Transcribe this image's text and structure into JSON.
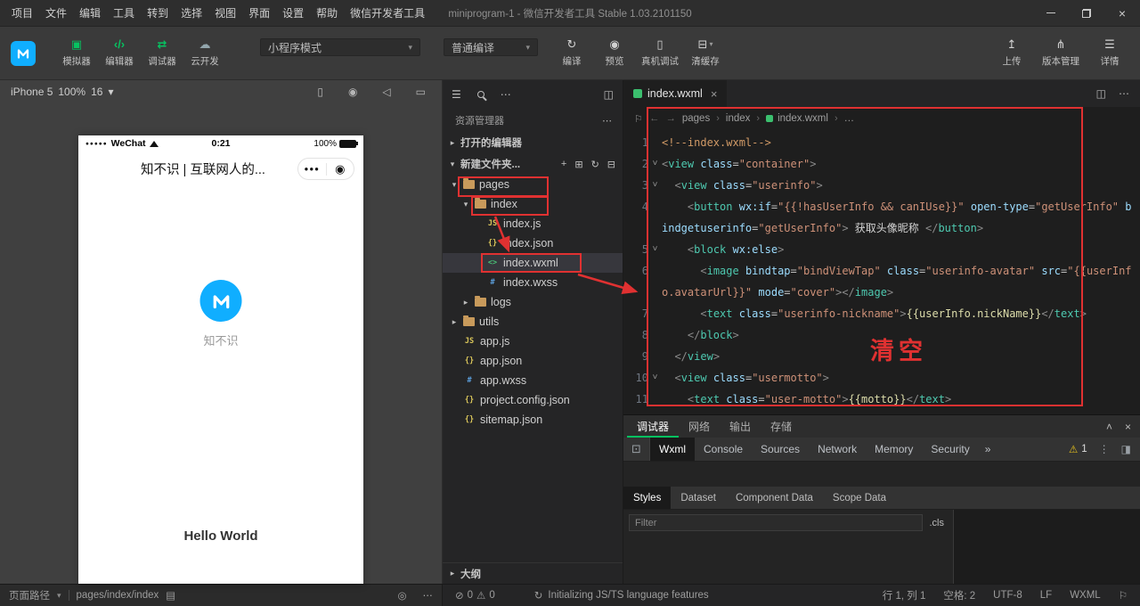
{
  "colors": {
    "accent_green": "#07c160",
    "annotation_red": "#e03131",
    "brand_blue": "#10aeff"
  },
  "title_bar": {
    "menus": [
      "项目",
      "文件",
      "编辑",
      "工具",
      "转到",
      "选择",
      "视图",
      "界面",
      "设置",
      "帮助",
      "微信开发者工具"
    ],
    "title": "miniprogram-1 - 微信开发者工具 Stable 1.03.2101150"
  },
  "toolbar": {
    "mode_buttons": [
      {
        "name": "simulator",
        "label": "模拟器",
        "icon": "▣",
        "style": "ic-green"
      },
      {
        "name": "editor",
        "label": "编辑器",
        "icon": "‹/›",
        "style": "ic-green"
      },
      {
        "name": "debugger",
        "label": "调试器",
        "icon": "⇄",
        "style": "ic-green"
      },
      {
        "name": "cloud-dev",
        "label": "云开发",
        "icon": "☁",
        "style": "ic-gray"
      }
    ],
    "mode_select": "小程序模式",
    "compile_select": "普通编译",
    "actions": [
      {
        "name": "compile",
        "label": "编译",
        "icon": "↻"
      },
      {
        "name": "preview",
        "label": "预览",
        "icon": "◉"
      },
      {
        "name": "device-debug",
        "label": "真机调试",
        "icon": "▯"
      },
      {
        "name": "clear-cache",
        "label": "清缓存",
        "icon": "⊟",
        "caret": true
      }
    ],
    "right_actions": [
      {
        "name": "upload",
        "label": "上传",
        "icon": "↥"
      },
      {
        "name": "version-manage",
        "label": "版本管理",
        "icon": "⋔"
      },
      {
        "name": "details",
        "label": "详情",
        "icon": "☰"
      }
    ]
  },
  "simulator": {
    "device": "iPhone 5",
    "zoom": "100%",
    "extra": "16",
    "header_icons": [
      {
        "name": "rotate-device",
        "icon": "▯"
      },
      {
        "name": "record",
        "icon": "◉"
      },
      {
        "name": "mute",
        "icon": "◁"
      },
      {
        "name": "message",
        "icon": "▭"
      }
    ],
    "status": {
      "carrier": "WeChat",
      "time": "0:21",
      "battery": "100%"
    },
    "nav_title": "知不识 | 互联网人的...",
    "app_name": "知不识",
    "hello_text": "Hello World"
  },
  "explorer": {
    "title": "资源管理器",
    "open_editors_label": "打开的编辑器",
    "project_label": "新建文件夹...",
    "outline_label": "大纲",
    "tree": [
      {
        "label": "pages",
        "kind": "folder",
        "depth": 0,
        "open": true,
        "boxed": true
      },
      {
        "label": "index",
        "kind": "folder",
        "depth": 1,
        "open": true,
        "boxed": true
      },
      {
        "label": "index.js",
        "kind": "js",
        "depth": 2
      },
      {
        "label": "index.json",
        "kind": "json",
        "depth": 2
      },
      {
        "label": "index.wxml",
        "kind": "wxml",
        "depth": 2,
        "selected": true,
        "boxed": true
      },
      {
        "label": "index.wxss",
        "kind": "wxss",
        "depth": 2
      },
      {
        "label": "logs",
        "kind": "folder",
        "depth": 1,
        "open": false
      },
      {
        "label": "utils",
        "kind": "folder",
        "depth": 0,
        "open": false
      },
      {
        "label": "app.js",
        "kind": "js",
        "depth": 0
      },
      {
        "label": "app.json",
        "kind": "json",
        "depth": 0
      },
      {
        "label": "app.wxss",
        "kind": "wxss",
        "depth": 0
      },
      {
        "label": "project.config.json",
        "kind": "json",
        "depth": 0
      },
      {
        "label": "sitemap.json",
        "kind": "json",
        "depth": 0
      }
    ]
  },
  "editor": {
    "tab_label": "index.wxml",
    "breadcrumb": [
      "pages",
      "index",
      "index.wxml",
      "…"
    ],
    "annotation": "清空",
    "lines": [
      {
        "n": 1,
        "fold": false,
        "t": [
          [
            "cm",
            "<!--index.wxml-->"
          ]
        ]
      },
      {
        "n": 2,
        "fold": true,
        "t": [
          [
            "pn",
            "<"
          ],
          [
            "tg",
            "view"
          ],
          [
            "tx",
            " "
          ],
          [
            "at",
            "class"
          ],
          [
            "eq",
            "="
          ],
          [
            "st",
            "\"container\""
          ],
          [
            "pn",
            ">"
          ]
        ]
      },
      {
        "n": 3,
        "fold": true,
        "t": [
          [
            "tx",
            "  "
          ],
          [
            "pn",
            "<"
          ],
          [
            "tg",
            "view"
          ],
          [
            "tx",
            " "
          ],
          [
            "at",
            "class"
          ],
          [
            "eq",
            "="
          ],
          [
            "st",
            "\"userinfo\""
          ],
          [
            "pn",
            ">"
          ]
        ]
      },
      {
        "n": 4,
        "fold": false,
        "t": [
          [
            "tx",
            "    "
          ],
          [
            "pn",
            "<"
          ],
          [
            "tg",
            "button"
          ],
          [
            "tx",
            " "
          ],
          [
            "at",
            "wx:if"
          ],
          [
            "eq",
            "="
          ],
          [
            "st",
            "\"{{!hasUserInfo && canIUse}}\""
          ],
          [
            "tx",
            " "
          ],
          [
            "at",
            "open-type"
          ],
          [
            "eq",
            "="
          ],
          [
            "st",
            "\"getUserInfo\""
          ],
          [
            "tx",
            " "
          ],
          [
            "at",
            "bindgetuserinfo"
          ],
          [
            "eq",
            "="
          ],
          [
            "st",
            "\"getUserInfo\""
          ],
          [
            "pn",
            ">"
          ],
          [
            "tx",
            " 获取头像昵称 "
          ],
          [
            "pn",
            "</"
          ],
          [
            "tg",
            "button"
          ],
          [
            "pn",
            ">"
          ]
        ]
      },
      {
        "n": 5,
        "fold": true,
        "t": [
          [
            "tx",
            "    "
          ],
          [
            "pn",
            "<"
          ],
          [
            "tg",
            "block"
          ],
          [
            "tx",
            " "
          ],
          [
            "at",
            "wx:else"
          ],
          [
            "pn",
            ">"
          ]
        ]
      },
      {
        "n": 6,
        "fold": false,
        "t": [
          [
            "tx",
            "      "
          ],
          [
            "pn",
            "<"
          ],
          [
            "tg",
            "image"
          ],
          [
            "tx",
            " "
          ],
          [
            "at",
            "bindtap"
          ],
          [
            "eq",
            "="
          ],
          [
            "st",
            "\"bindViewTap\""
          ],
          [
            "tx",
            " "
          ],
          [
            "at",
            "class"
          ],
          [
            "eq",
            "="
          ],
          [
            "st",
            "\"userinfo-avatar\""
          ],
          [
            "tx",
            " "
          ],
          [
            "at",
            "src"
          ],
          [
            "eq",
            "="
          ],
          [
            "st",
            "\"{{userInfo.avatarUrl}}\""
          ],
          [
            "tx",
            " "
          ],
          [
            "at",
            "mode"
          ],
          [
            "eq",
            "="
          ],
          [
            "st",
            "\"cover\""
          ],
          [
            "pn",
            "></"
          ],
          [
            "tg",
            "image"
          ],
          [
            "pn",
            ">"
          ]
        ]
      },
      {
        "n": 7,
        "fold": false,
        "t": [
          [
            "tx",
            "      "
          ],
          [
            "pn",
            "<"
          ],
          [
            "tg",
            "text"
          ],
          [
            "tx",
            " "
          ],
          [
            "at",
            "class"
          ],
          [
            "eq",
            "="
          ],
          [
            "st",
            "\"userinfo-nickname\""
          ],
          [
            "pn",
            ">"
          ],
          [
            "mu",
            "{{userInfo.nickName}}"
          ],
          [
            "pn",
            "</"
          ],
          [
            "tg",
            "text"
          ],
          [
            "pn",
            ">"
          ]
        ]
      },
      {
        "n": 8,
        "fold": false,
        "t": [
          [
            "tx",
            "    "
          ],
          [
            "pn",
            "</"
          ],
          [
            "tg",
            "block"
          ],
          [
            "pn",
            ">"
          ]
        ]
      },
      {
        "n": 9,
        "fold": false,
        "t": [
          [
            "tx",
            "  "
          ],
          [
            "pn",
            "</"
          ],
          [
            "tg",
            "view"
          ],
          [
            "pn",
            ">"
          ]
        ]
      },
      {
        "n": 10,
        "fold": true,
        "t": [
          [
            "tx",
            "  "
          ],
          [
            "pn",
            "<"
          ],
          [
            "tg",
            "view"
          ],
          [
            "tx",
            " "
          ],
          [
            "at",
            "class"
          ],
          [
            "eq",
            "="
          ],
          [
            "st",
            "\"usermotto\""
          ],
          [
            "pn",
            ">"
          ]
        ]
      },
      {
        "n": 11,
        "fold": false,
        "t": [
          [
            "tx",
            "    "
          ],
          [
            "pn",
            "<"
          ],
          [
            "tg",
            "text"
          ],
          [
            "tx",
            " "
          ],
          [
            "at",
            "class"
          ],
          [
            "eq",
            "="
          ],
          [
            "st",
            "\"user-motto\""
          ],
          [
            "pn",
            ">"
          ],
          [
            "mu",
            "{{motto}}"
          ],
          [
            "pn",
            "</"
          ],
          [
            "tg",
            "text"
          ],
          [
            "pn",
            ">"
          ]
        ]
      }
    ]
  },
  "debugger": {
    "panel_tabs": [
      {
        "label": "调试器",
        "active": true
      },
      {
        "label": "网络",
        "active": false
      },
      {
        "label": "输出",
        "active": false
      },
      {
        "label": "存储",
        "active": false
      }
    ],
    "devtools_tabs": [
      {
        "label": "Wxml",
        "active": true
      },
      {
        "label": "Console",
        "active": false
      },
      {
        "label": "Sources",
        "active": false
      },
      {
        "label": "Network",
        "active": false
      },
      {
        "label": "Memory",
        "active": false
      },
      {
        "label": "Security",
        "active": false
      }
    ],
    "overflow": "»",
    "warning_count": "1",
    "subtabs": [
      {
        "label": "Styles",
        "active": true
      },
      {
        "label": "Dataset",
        "active": false
      },
      {
        "label": "Component Data",
        "active": false
      },
      {
        "label": "Scope Data",
        "active": false
      }
    ],
    "filter_placeholder": "Filter",
    "cls_label": ".cls"
  },
  "status_bar": {
    "page_path_label": "页面路径",
    "page_path": "pages/index/index",
    "errors": "0",
    "warnings": "0",
    "message": "Initializing JS/TS language features",
    "right_items": [
      "行 1, 列 1",
      "空格: 2",
      "UTF-8",
      "LF",
      "WXML"
    ]
  }
}
